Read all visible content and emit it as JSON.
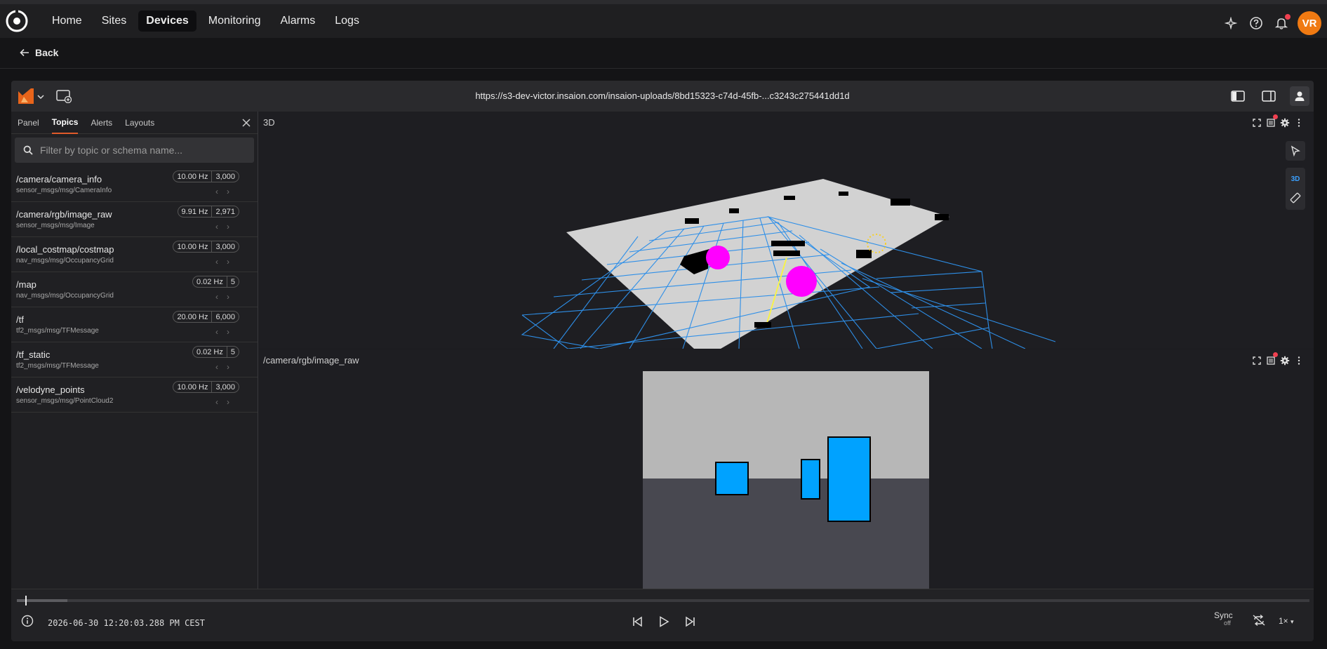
{
  "nav": {
    "items": [
      "Home",
      "Sites",
      "Devices",
      "Monitoring",
      "Alarms",
      "Logs"
    ],
    "active": "Devices",
    "avatar_initials": "VR"
  },
  "back_label": "Back",
  "app": {
    "url": "https://s3-dev-victor.insaion.com/insaion-uploads/8bd15323-c74d-45fb-...c3243c275441dd1d"
  },
  "sidebar": {
    "tabs": [
      "Panel",
      "Topics",
      "Alerts",
      "Layouts"
    ],
    "active_tab": "Topics",
    "search_placeholder": "Filter by topic or schema name...",
    "topics": [
      {
        "name": "/camera/camera_info",
        "schema": "sensor_msgs/msg/CameraInfo",
        "hz": "10.00 Hz",
        "count": "3,000"
      },
      {
        "name": "/camera/rgb/image_raw",
        "schema": "sensor_msgs/msg/Image",
        "hz": "9.91 Hz",
        "count": "2,971"
      },
      {
        "name": "/local_costmap/costmap",
        "schema": "nav_msgs/msg/OccupancyGrid",
        "hz": "10.00 Hz",
        "count": "3,000"
      },
      {
        "name": "/map",
        "schema": "nav_msgs/msg/OccupancyGrid",
        "hz": "0.02 Hz",
        "count": "5"
      },
      {
        "name": "/tf",
        "schema": "tf2_msgs/msg/TFMessage",
        "hz": "20.00 Hz",
        "count": "6,000"
      },
      {
        "name": "/tf_static",
        "schema": "tf2_msgs/msg/TFMessage",
        "hz": "0.02 Hz",
        "count": "5"
      },
      {
        "name": "/velodyne_points",
        "schema": "sensor_msgs/msg/PointCloud2",
        "hz": "10.00 Hz",
        "count": "3,000"
      }
    ]
  },
  "panels": {
    "scene_title": "3D",
    "scene_mode": "3D",
    "image_title": "/camera/rgb/image_raw"
  },
  "playback": {
    "timestamp": "2026-06-30 12:20:03.288 PM CEST",
    "sync_label": "Sync",
    "sync_state": "off",
    "speed": "1×"
  },
  "colors": {
    "accent_orange": "#f07a12",
    "grid_blue": "#2e8fe8",
    "magenta": "#ff00ff",
    "cyan_box": "#00a2ff"
  }
}
